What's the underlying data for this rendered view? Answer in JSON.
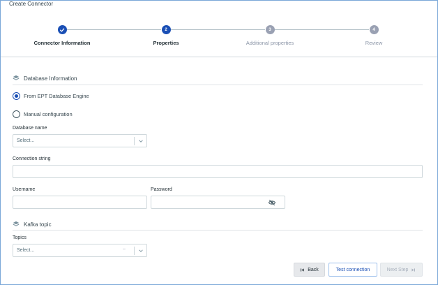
{
  "window": {
    "title": "Create Connector"
  },
  "stepper": {
    "steps": [
      {
        "label": "Connector Information",
        "state": "done",
        "number": ""
      },
      {
        "label": "Properties",
        "state": "active",
        "number": "2"
      },
      {
        "label": "Additional properties",
        "state": "pending",
        "number": "3"
      },
      {
        "label": "Review",
        "state": "pending",
        "number": "4"
      }
    ]
  },
  "database_section": {
    "title": "Database Information",
    "radio_options": [
      {
        "label": "From EPT Database Engine",
        "checked": true
      },
      {
        "label": "Manual configuration",
        "checked": false
      }
    ],
    "database_name": {
      "label": "Database name",
      "placeholder": "Select..."
    },
    "connection_string": {
      "label": "Connection string",
      "value": ""
    },
    "username": {
      "label": "Username",
      "value": ""
    },
    "password": {
      "label": "Password",
      "value": ""
    }
  },
  "kafka_section": {
    "title": "Kafka topic",
    "topics": {
      "label": "Topics",
      "placeholder": "Select..."
    }
  },
  "footer": {
    "back_label": "Back",
    "test_label": "Test connection",
    "next_label": "Next Step"
  },
  "colors": {
    "accent": "#1a4fb5",
    "pending": "#9aa1b3",
    "border": "#cfd8dc"
  },
  "icons": [
    "check-icon",
    "layers-icon",
    "chevron-down-icon",
    "eye-off-icon",
    "first-page-icon",
    "last-page-icon"
  ]
}
